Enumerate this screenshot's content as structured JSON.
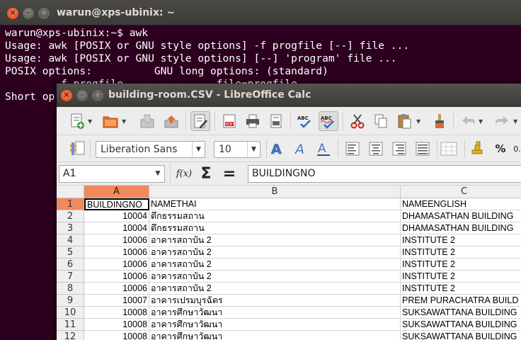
{
  "terminal": {
    "title": "warun@xps-ubinix: ~",
    "lines": [
      "warun@xps-ubinix:~$ awk",
      "Usage: awk [POSIX or GNU style options] -f progfile [--] file ...",
      "Usage: awk [POSIX or GNU style options] [--] 'program' file ...",
      "POSIX options:          GNU long options: (standard)",
      "        -f progfile             --file=progfile",
      "",
      "",
      "Short op"
    ]
  },
  "calc": {
    "title": "building-room.CSV - LibreOffice Calc",
    "toolbar1": {
      "icons": [
        "new-document-icon",
        "open-folder-icon",
        "save-icon",
        "export-icon",
        "edit-file-icon",
        "export-pdf-icon",
        "print-icon",
        "print-preview-icon",
        "spellcheck-icon",
        "autospellcheck-icon",
        "cut-icon",
        "copy-icon",
        "paste-icon",
        "clone-formatting-icon",
        "undo-icon",
        "redo-icon"
      ]
    },
    "toolbar2": {
      "font_name": "Liberation Sans",
      "font_size": "10"
    },
    "formula_bar": {
      "cell_ref": "A1",
      "content": "BUILDINGNO",
      "fx_label": "f(x)",
      "sum_label": "Σ",
      "equals_label": "="
    },
    "columns": [
      "A",
      "B",
      "C"
    ],
    "rows": [
      {
        "num": "1",
        "a": "BUILDINGNO",
        "b": "NAMETHAI",
        "c": "NAMEENGLISH"
      },
      {
        "num": "2",
        "a": "10004",
        "b": "ตึกธรรมสถาน",
        "c": "DHAMASATHAN BUILDING"
      },
      {
        "num": "3",
        "a": "10004",
        "b": "ตึกธรรมสถาน",
        "c": "DHAMASATHAN BUILDING"
      },
      {
        "num": "4",
        "a": "10006",
        "b": "อาคารสถาบัน 2",
        "c": "INSTITUTE 2"
      },
      {
        "num": "5",
        "a": "10006",
        "b": "อาคารสถาบัน 2",
        "c": "INSTITUTE 2"
      },
      {
        "num": "6",
        "a": "10006",
        "b": "อาคารสถาบัน 2",
        "c": "INSTITUTE 2"
      },
      {
        "num": "7",
        "a": "10006",
        "b": "อาคารสถาบัน 2",
        "c": "INSTITUTE 2"
      },
      {
        "num": "8",
        "a": "10006",
        "b": "อาคารสถาบัน 2",
        "c": "INSTITUTE 2"
      },
      {
        "num": "9",
        "a": "10007",
        "b": "อาคารเปรมบุรฉัตร",
        "c": "PREM PURACHATRA BUILD"
      },
      {
        "num": "10",
        "a": "10008",
        "b": "อาคารศึกษาวัฒนา",
        "c": "SUKSAWATTANA BUILDING"
      },
      {
        "num": "11",
        "a": "10008",
        "b": "อาคารศึกษาวัฒนา",
        "c": "SUKSAWATTANA BUILDING"
      },
      {
        "num": "12",
        "a": "10008",
        "b": "อาคารศึกษาวัฒนา",
        "c": "SUKSAWATTANA BUILDING"
      }
    ],
    "colors": {
      "selected_header": "#f08a5d",
      "close_button": "#e95420"
    }
  }
}
